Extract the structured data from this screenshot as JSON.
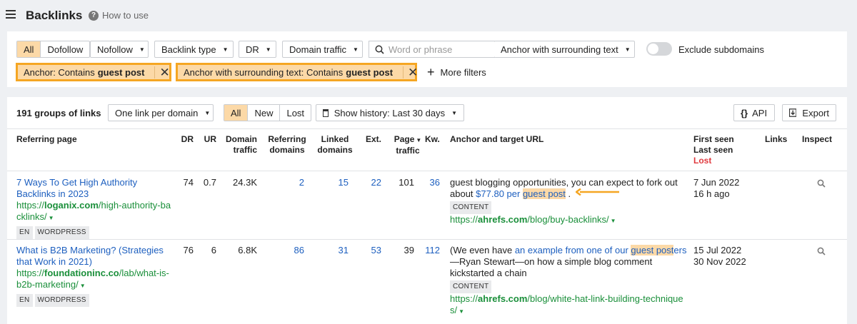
{
  "header": {
    "title": "Backlinks",
    "how_to_use": "How to use"
  },
  "filters": {
    "link_type_tabs": [
      "All",
      "Dofollow"
    ],
    "nofollow": "Nofollow",
    "backlink_type": "Backlink type",
    "dr": "DR",
    "domain_traffic": "Domain traffic",
    "search_placeholder": "Word or phrase",
    "search_scope": "Anchor with surrounding text",
    "exclude_subdomains": "Exclude subdomains",
    "active_chips": [
      {
        "prefix": "Anchor: Contains",
        "value": "guest post"
      },
      {
        "prefix": "Anchor with surrounding text: Contains",
        "value": "guest post"
      }
    ],
    "more_filters": "More filters"
  },
  "results": {
    "count_label": "191 groups of links",
    "grouping": "One link per domain",
    "new_lost_tabs": [
      "All",
      "New",
      "Lost"
    ],
    "history": "Show history: Last 30 days",
    "api": "API",
    "export": "Export"
  },
  "table": {
    "columns": {
      "referring_page": "Referring page",
      "dr": "DR",
      "ur": "UR",
      "domain_traffic": [
        "Domain",
        "traffic"
      ],
      "referring_domains": [
        "Referring",
        "domains"
      ],
      "linked_domains": [
        "Linked",
        "domains"
      ],
      "ext": "Ext.",
      "page_traffic": [
        "Page",
        "traffic"
      ],
      "kw": "Kw.",
      "anchor": "Anchor and target URL",
      "first_seen": "First seen",
      "last_seen": "Last seen",
      "lost": "Lost",
      "links": "Links",
      "inspect": "Inspect"
    },
    "rows": [
      {
        "title_lines": [
          "7 Ways To Get High Authority",
          "Backlinks in 2023"
        ],
        "url_prefix": "https://",
        "url_domain": "loganix.com",
        "url_rest_lines": [
          "/high-authority-ba",
          "cklinks/"
        ],
        "tags": [
          "EN",
          "WORDPRESS"
        ],
        "dr": "74",
        "ur": "0.7",
        "domain_traffic": "24.3K",
        "referring_domains": "2",
        "linked_domains": "15",
        "ext": "22",
        "page_traffic": "101",
        "kw": "36",
        "anchor_line1": "guest blogging opportunities, you can expect to fork out",
        "anchor_line2_pre": "about ",
        "anchor_line2_link": "$77.80 per ",
        "anchor_line2_hl": "guest post",
        "anchor_line2_post": " .",
        "content_tag": "CONTENT",
        "target_prefix": "https://",
        "target_domain": "ahrefs.com",
        "target_rest": "/blog/buy-backlinks/",
        "first_seen": "7 Jun 2022",
        "last_seen": "16 h ago"
      },
      {
        "title_lines": [
          "What is B2B Marketing? (Strategies",
          "that Work in 2021)"
        ],
        "url_prefix": "https://",
        "url_domain": "foundationinc.co",
        "url_rest_lines": [
          "/lab/what-is-",
          "b2b-marketing/"
        ],
        "tags": [
          "EN",
          "WORDPRESS"
        ],
        "dr": "76",
        "ur": "6",
        "domain_traffic": "6.8K",
        "referring_domains": "86",
        "linked_domains": "31",
        "ext": "53",
        "page_traffic": "39",
        "kw": "112",
        "anchor_line1_pre": "(We even have ",
        "anchor_line1_link": "an example from one of our ",
        "anchor_line1_hl": "guest post",
        "anchor_line1_link2": "ers",
        "anchor_line2": "—Ryan Stewart—on how a simple blog comment",
        "anchor_line3": "kickstarted a chain",
        "content_tag": "CONTENT",
        "target_prefix": "https://",
        "target_domain": "ahrefs.com",
        "target_rest_lines": [
          "/blog/white-hat-link-building-technique",
          "s/"
        ],
        "first_seen": "15 Jul 2022",
        "last_seen": "30 Nov 2022"
      }
    ]
  },
  "colors": {
    "accent_orange": "#f5a623",
    "chip_fill": "#fcd9a7",
    "link_blue": "#1d5fbf",
    "url_green": "#1a8f3a",
    "lost_red": "#e0393e"
  }
}
